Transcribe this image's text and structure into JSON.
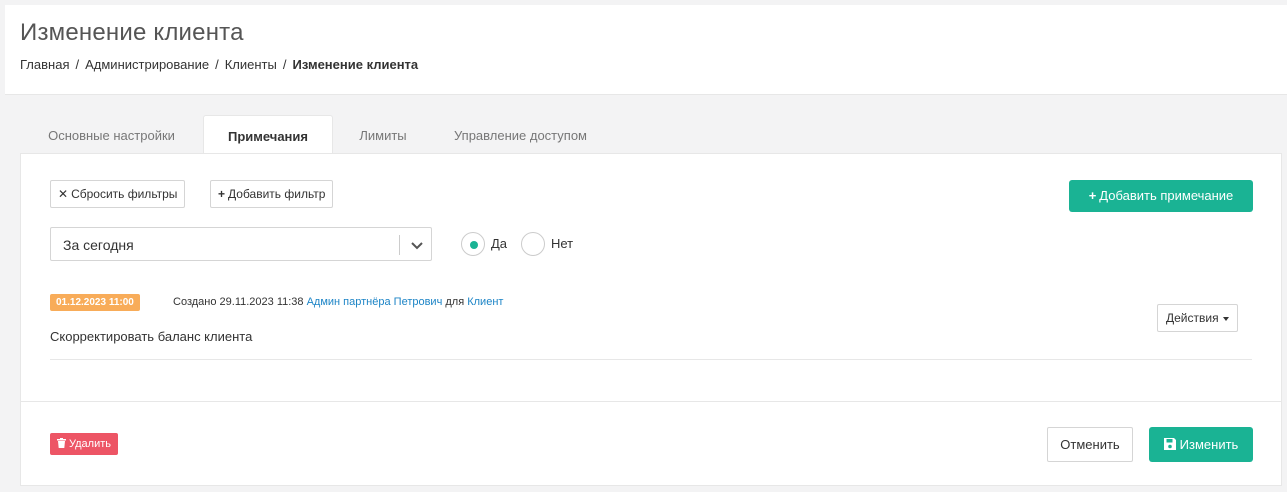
{
  "header": {
    "title": "Изменение клиента",
    "breadcrumb": [
      "Главная",
      "Администрирование",
      "Клиенты",
      "Изменение клиента"
    ]
  },
  "tabs": [
    {
      "label": "Основные настройки",
      "active": false
    },
    {
      "label": "Примечания",
      "active": true
    },
    {
      "label": "Лимиты",
      "active": false
    },
    {
      "label": "Управление доступом",
      "active": false
    }
  ],
  "filters": {
    "reset_label": "Сбросить фильтры",
    "add_label": "Добавить фильтр",
    "period_value": "За сегодня",
    "radio_yes": "Да",
    "radio_no": "Нет",
    "selected_radio": "yes"
  },
  "add_note_label": "Добавить примечание",
  "note": {
    "date_badge": "01.12.2023 11:00",
    "created_prefix": "Создано 29.11.2023 11:38",
    "author": "Админ партнёра Петрович",
    "for_word": "для",
    "target": "Клиент",
    "text": "Скорректировать баланс клиента",
    "actions_label": "Действия"
  },
  "footer": {
    "delete_label": "Удалить",
    "cancel_label": "Отменить",
    "save_label": "Изменить"
  },
  "colors": {
    "accent": "#1ab394",
    "danger": "#ed5565",
    "warning": "#f8ac59",
    "link": "#1c84c6"
  },
  "icons": {
    "reset": "times-icon",
    "add_filter": "plus-icon",
    "add_note": "plus-icon",
    "dropdown": "chevron-down-icon",
    "actions": "caret-down-icon",
    "delete": "trash-icon",
    "save": "floppy-disk-icon"
  }
}
